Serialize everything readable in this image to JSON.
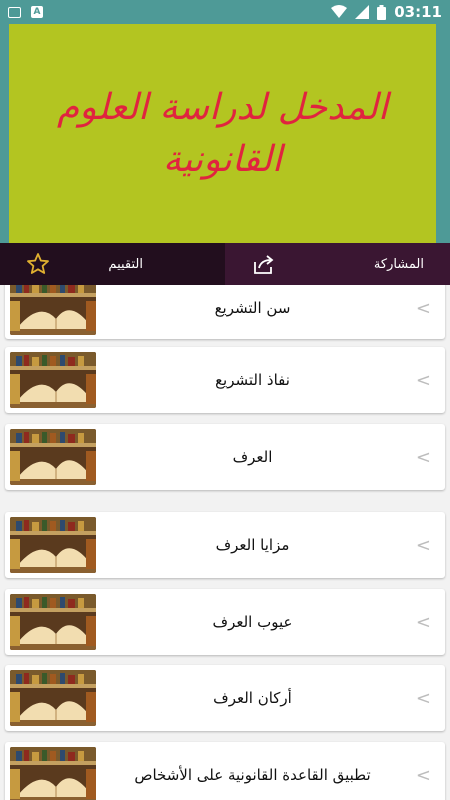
{
  "statusbar": {
    "time": "03:11",
    "left_icons": [
      "image-icon",
      "a-icon"
    ],
    "right_icons": [
      "wifi-icon",
      "signal-icon",
      "battery-icon"
    ]
  },
  "hero": {
    "line1": "المدخل لدراسة العلوم",
    "line2": "القانونية",
    "bg": "#b3c521",
    "text_color": "#e0243f"
  },
  "toolbar": {
    "rate_label": "التقييم",
    "share_label": "المشاركة",
    "rate_icon": "star-icon",
    "share_icon": "share-icon"
  },
  "items": [
    {
      "title": "سن التشريع"
    },
    {
      "title": "نفاذ التشريع"
    },
    {
      "title": "العرف"
    },
    {
      "title": "مزايا العرف"
    },
    {
      "title": "عيوب العرف"
    },
    {
      "title": "أركان العرف"
    },
    {
      "title": "تطبيق القاعدة القانونية على الأشخاص"
    }
  ],
  "colors": {
    "teal": "#4e9a97",
    "toolbar_dark": "#220e1e",
    "toolbar_light": "#3a1632"
  }
}
